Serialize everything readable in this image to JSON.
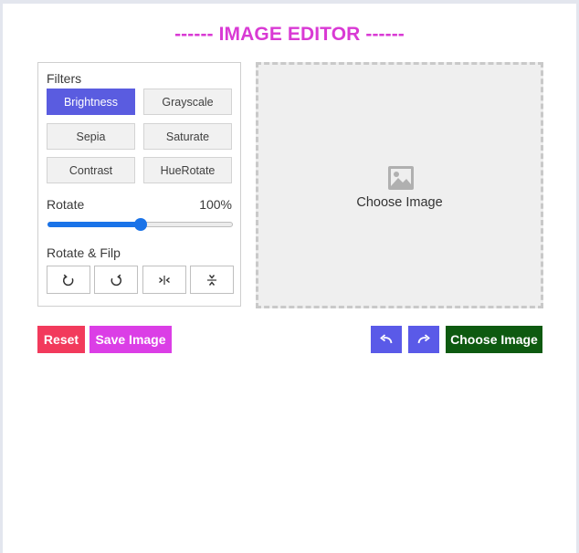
{
  "title": "------ IMAGE EDITOR ------",
  "filters": {
    "heading": "Filters",
    "items": [
      {
        "label": "Brightness",
        "active": true
      },
      {
        "label": "Grayscale",
        "active": false
      },
      {
        "label": "Sepia",
        "active": false
      },
      {
        "label": "Saturate",
        "active": false
      },
      {
        "label": "Contrast",
        "active": false
      },
      {
        "label": "HueRotate",
        "active": false
      }
    ]
  },
  "slider": {
    "label": "Rotate",
    "value_text": "100%",
    "level_fraction": 0.5
  },
  "rotate_flip": {
    "heading": "Rotate & Filp",
    "buttons": [
      {
        "icon": "rotate-left-icon"
      },
      {
        "icon": "rotate-right-icon"
      },
      {
        "icon": "flip-horizontal-icon"
      },
      {
        "icon": "flip-vertical-icon"
      }
    ]
  },
  "preview": {
    "text": "Choose Image",
    "icon": "image-icon"
  },
  "actions": {
    "reset_label": "Reset",
    "save_label": "Save Image",
    "undo_icon": "undo-icon",
    "redo_icon": "redo-icon",
    "choose_label": "Choose Image"
  },
  "colors": {
    "title": "#d93ad4",
    "active_filter": "#5a5ce0",
    "slider": "#1a73e8",
    "reset": "#f23a5c",
    "save": "#db3ee6",
    "undo_redo": "#5a5ae8",
    "choose": "#0e5a10"
  }
}
